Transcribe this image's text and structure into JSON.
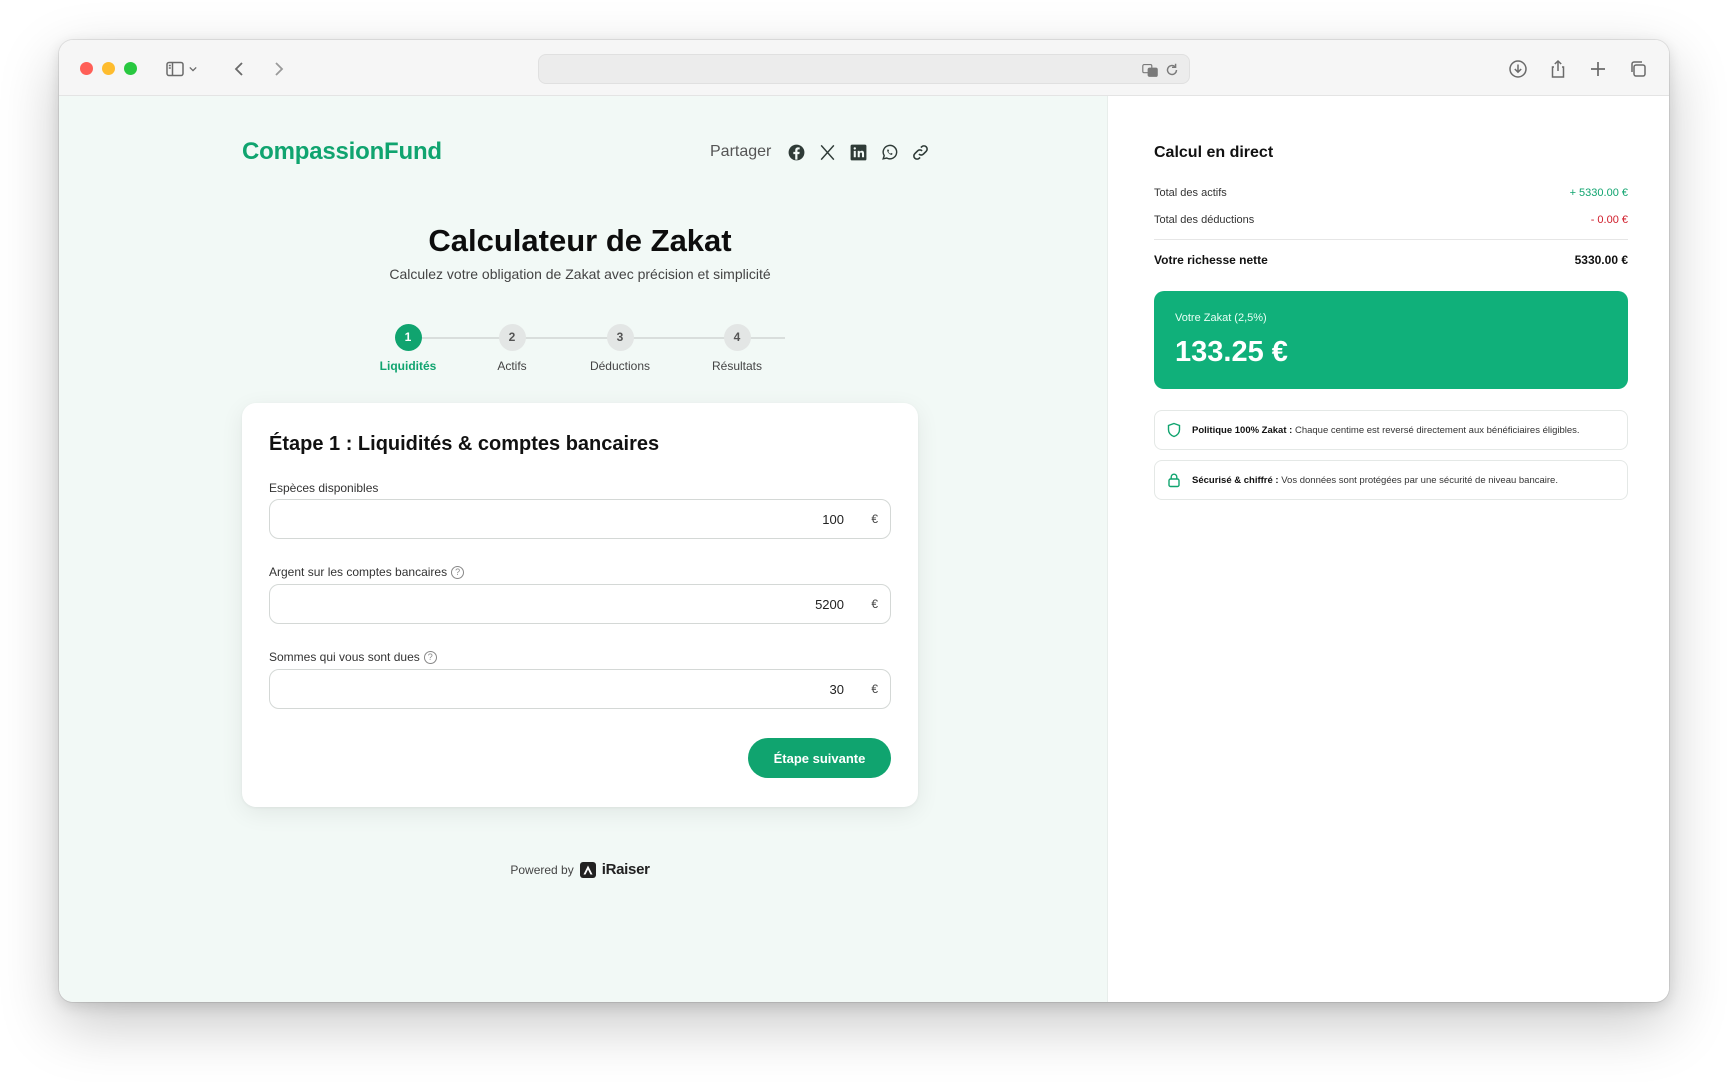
{
  "brand": {
    "name": "CompassionFund"
  },
  "share": {
    "label": "Partager",
    "icons": [
      "facebook-icon",
      "x-icon",
      "linkedin-icon",
      "whatsapp-icon",
      "link-icon"
    ]
  },
  "hero": {
    "title": "Calculateur de Zakat",
    "subtitle": "Calculez votre obligation de Zakat avec précision et simplicité"
  },
  "steps": [
    {
      "number": "1",
      "label": "Liquidités",
      "active": true
    },
    {
      "number": "2",
      "label": "Actifs",
      "active": false
    },
    {
      "number": "3",
      "label": "Déductions",
      "active": false
    },
    {
      "number": "4",
      "label": "Résultats",
      "active": false
    }
  ],
  "form": {
    "heading": "Étape 1 : Liquidités & comptes bancaires",
    "fields": [
      {
        "label": "Espèces disponibles",
        "value": "100",
        "currency": "€",
        "help": false
      },
      {
        "label": "Argent sur les comptes bancaires",
        "value": "5200",
        "currency": "€",
        "help": true
      },
      {
        "label": "Sommes qui vous sont dues",
        "value": "30",
        "currency": "€",
        "help": true
      }
    ],
    "next_label": "Étape suivante",
    "help_glyph": "?"
  },
  "footer": {
    "powered_by": "Powered by",
    "provider": "iRaiser"
  },
  "summary": {
    "title": "Calcul en direct",
    "assets_label": "Total des actifs",
    "assets_value": "+ 5330.00 €",
    "deductions_label": "Total des déductions",
    "deductions_value": "- 0.00 €",
    "net_label": "Votre richesse nette",
    "net_value": "5330.00 €",
    "zakat_label": "Votre Zakat (2,5%)",
    "zakat_value": "133.25 €",
    "info": [
      {
        "icon": "shield-icon",
        "bold": "Politique 100% Zakat :",
        "text": " Chaque centime est reversé directement aux bénéficiaires éligibles."
      },
      {
        "icon": "lock-icon",
        "bold": "Sécurisé & chiffré :",
        "text": " Vos données sont protégées par une sécurité de niveau bancaire."
      }
    ]
  },
  "colors": {
    "accent": "#10a46f",
    "negative": "#d01c2a",
    "panel_bg": "#f2f9f6"
  }
}
